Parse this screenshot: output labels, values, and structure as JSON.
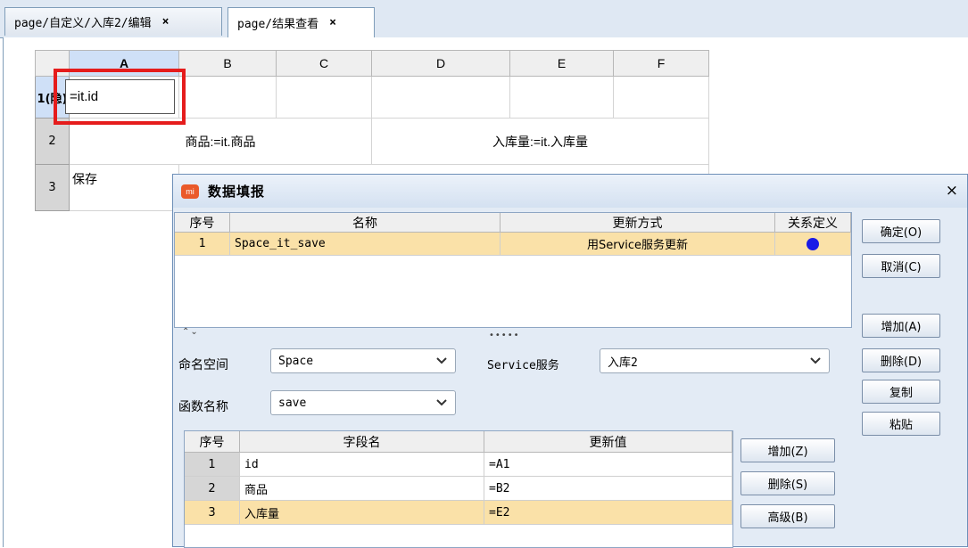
{
  "tabs": [
    {
      "label": "page/自定义/入库2/编辑",
      "close": "×"
    },
    {
      "label": "page/结果查看",
      "close": "×"
    }
  ],
  "sheet": {
    "columns": [
      "A",
      "B",
      "C",
      "D",
      "E",
      "F"
    ],
    "rows": [
      "1(隐)",
      "2",
      "3"
    ],
    "cells": {
      "a1": "=it.id",
      "b2": "商品:=it.商品",
      "e2": "入库量:=it.入库量",
      "a3": "保存"
    }
  },
  "dialog": {
    "logo": "mi",
    "title": "数据填报",
    "close": "×",
    "table": {
      "headers": [
        "序号",
        "名称",
        "更新方式",
        "关系定义"
      ],
      "rows": [
        {
          "index": "1",
          "name": "Space_it_save",
          "method": "用Service服务更新",
          "relation": "blue-dot"
        }
      ]
    },
    "right_buttons": {
      "ok": "确定(O)",
      "cancel": "取消(C)",
      "add": "增加(A)",
      "delete": "删除(D)",
      "copy": "复制",
      "paste": "粘贴"
    },
    "form": {
      "namespace_label": "命名空间",
      "namespace_value": "Space",
      "service_label": "Service服务",
      "service_value": "入库2",
      "function_label": "函数名称",
      "function_value": "save"
    },
    "fields": {
      "headers": [
        "序号",
        "字段名",
        "更新值"
      ],
      "rows": [
        {
          "index": "1",
          "field": "id",
          "value": "=A1"
        },
        {
          "index": "2",
          "field": "商品",
          "value": "=B2"
        },
        {
          "index": "3",
          "field": "入库量",
          "value": "=E2"
        }
      ]
    },
    "field_buttons": {
      "add": "增加(Z)",
      "delete": "删除(S)",
      "advanced": "高级(B)"
    }
  },
  "colors": {
    "selection_border": "#e51c1c",
    "selected_row": "#fae1a8",
    "relation_dot": "#1a1ae6"
  }
}
